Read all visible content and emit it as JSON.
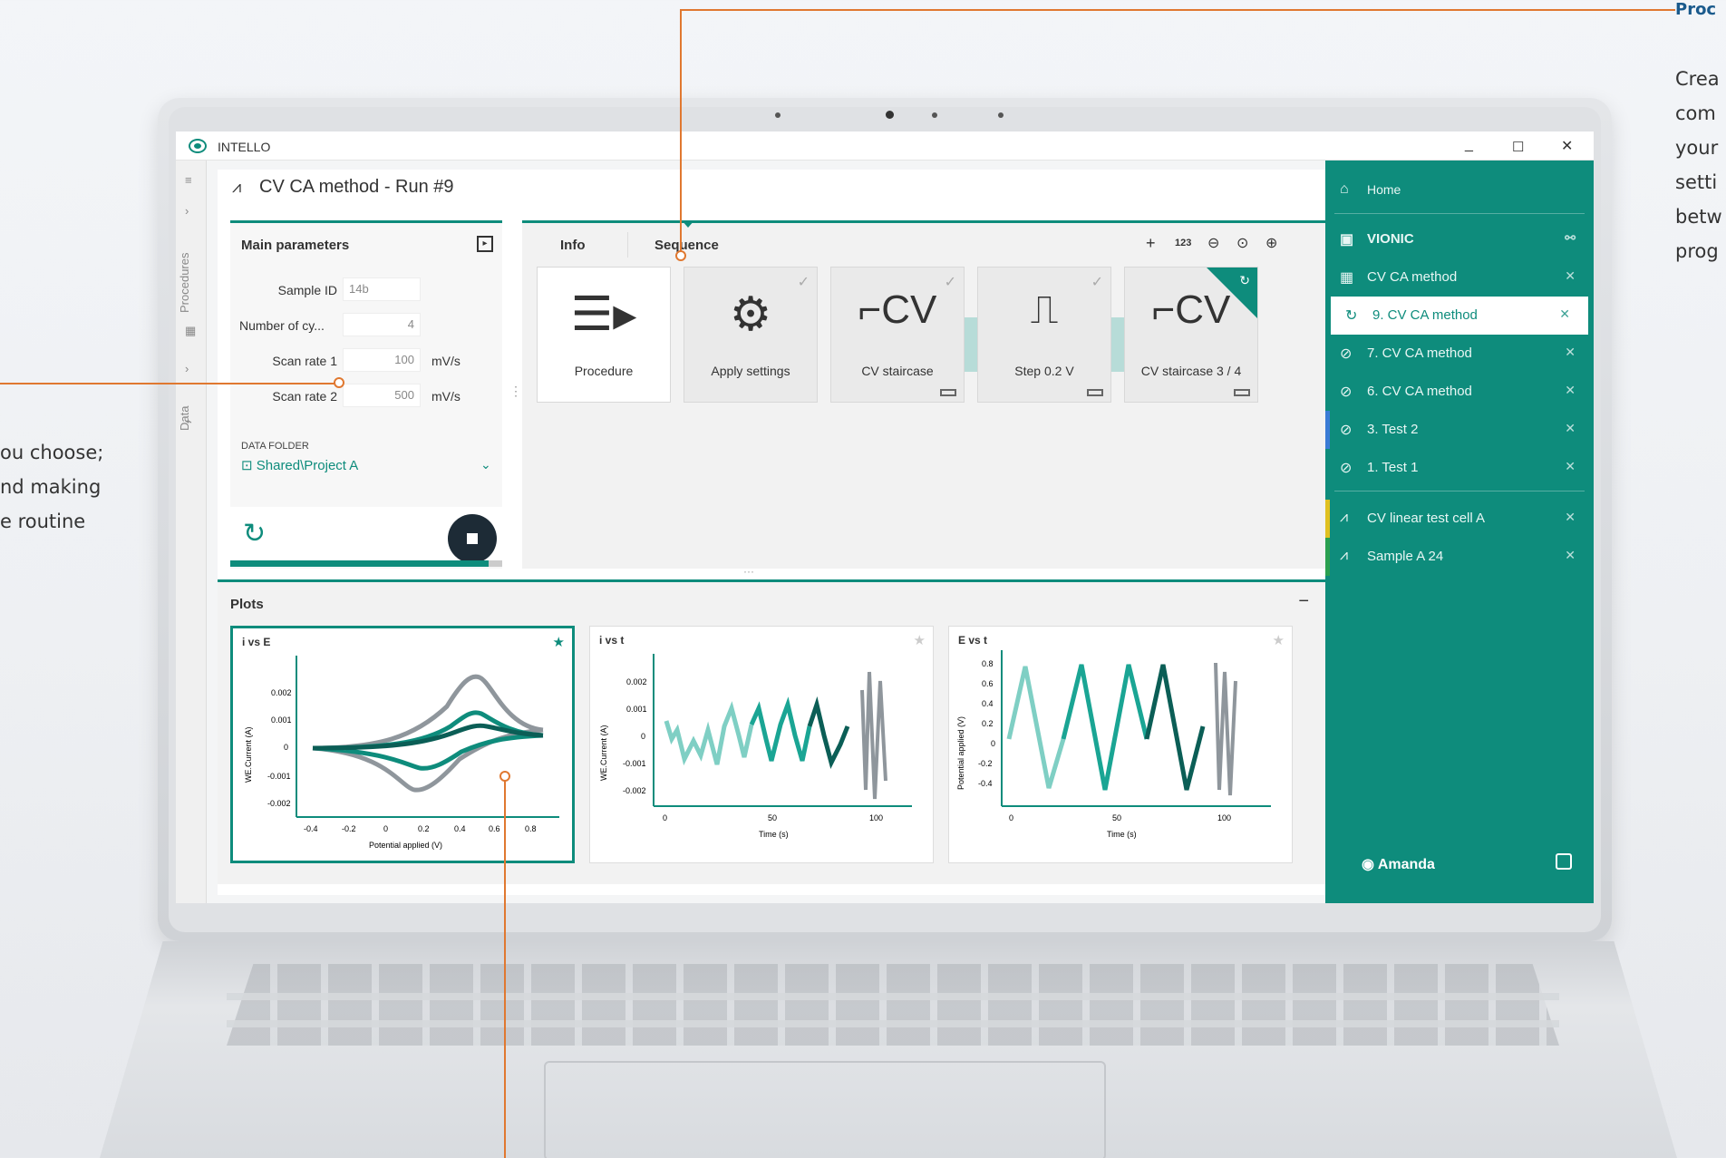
{
  "callouts": {
    "right_heading": "Proc",
    "right_lines": [
      "Crea",
      "com",
      "your",
      "setti",
      "betw",
      "prog"
    ],
    "left_lines": [
      "ou choose;",
      "nd making",
      "e routine"
    ]
  },
  "app": {
    "name": "INTELLO",
    "window_controls": {
      "minimize": "_",
      "maximize": "☐",
      "close": "✕"
    }
  },
  "left_rail": {
    "procedures_label": "Procedures",
    "data_label": "Data"
  },
  "run": {
    "title": "CV CA method - Run #9"
  },
  "main_parameters": {
    "header": "Main parameters",
    "fields": [
      {
        "label": "Sample ID",
        "value": "14b",
        "unit": ""
      },
      {
        "label": "Number of cy...",
        "value": "4",
        "unit": ""
      },
      {
        "label": "Scan rate 1",
        "value": "100",
        "unit": "mV/s"
      },
      {
        "label": "Scan rate 2",
        "value": "500",
        "unit": "mV/s"
      }
    ],
    "data_folder_label": "DATA FOLDER",
    "data_folder_value": "Shared\\Project A",
    "progress": 0.95
  },
  "sequence_panel": {
    "tabs": [
      "Info",
      "Sequence"
    ],
    "active_tab": "Sequence",
    "toolbar": {
      "add": "+",
      "numbers": "123",
      "zoom_out": "−",
      "zoom_fit": "⌕",
      "zoom_in": "+"
    },
    "cards": [
      {
        "label": "Procedure",
        "icon": "document-arrow-icon",
        "state": "none"
      },
      {
        "label": "Apply settings",
        "icon": "gear-icon",
        "state": "done"
      },
      {
        "label": "CV staircase",
        "icon": "cv-staircase-icon",
        "state": "done"
      },
      {
        "label": "Step 0.2 V",
        "icon": "step-pulse-icon",
        "state": "done"
      },
      {
        "label": "CV staircase 3 / 4",
        "icon": "cv-staircase-icon",
        "state": "running"
      }
    ]
  },
  "plots_panel": {
    "header": "Plots",
    "plots": [
      {
        "title": "i vs E",
        "starred": true,
        "y_ticks": [
          "0.002",
          "0.001",
          "0",
          "-0.001",
          "-0.002"
        ],
        "x_ticks": [
          "-0.4",
          "-0.2",
          "0",
          "0.2",
          "0.4",
          "0.6",
          "0.8"
        ],
        "xlabel": "Potential applied (V)",
        "ylabel": "WE.Current (A)"
      },
      {
        "title": "i vs t",
        "starred": false,
        "y_ticks": [
          "0.002",
          "0.001",
          "0",
          "-0.001",
          "-0.002"
        ],
        "x_ticks": [
          "0",
          "50",
          "100"
        ],
        "xlabel": "Time (s)",
        "ylabel": "WE.Current (A)"
      },
      {
        "title": "E vs t",
        "starred": false,
        "y_ticks": [
          "0.8",
          "0.6",
          "0.4",
          "0.2",
          "0",
          "-0.2",
          "-0.4"
        ],
        "x_ticks": [
          "0",
          "50",
          "100"
        ],
        "xlabel": "Time (s)",
        "ylabel": "Potential applied (V)"
      }
    ]
  },
  "sidebar": {
    "home": "Home",
    "device": "VIONIC",
    "items": [
      {
        "label": "CV CA method",
        "icon": "grid-icon",
        "active": false,
        "bar": ""
      },
      {
        "label": "9. CV CA method",
        "icon": "running-icon",
        "active": true,
        "bar": ""
      },
      {
        "label": "7. CV CA method",
        "icon": "check-circle-icon",
        "active": false,
        "bar": ""
      },
      {
        "label": "6. CV CA method",
        "icon": "check-circle-icon",
        "active": false,
        "bar": ""
      },
      {
        "label": "3. Test 2",
        "icon": "check-circle-icon",
        "active": false,
        "bar": "#3a7bd5"
      },
      {
        "label": "1. Test 1",
        "icon": "check-circle-icon",
        "active": false,
        "bar": ""
      }
    ],
    "data_items": [
      {
        "label": "CV linear test cell A",
        "bar": "#e0c020"
      },
      {
        "label": "Sample A 24",
        "bar": "#2aa050"
      }
    ],
    "user": "Amanda"
  },
  "colors": {
    "accent": "#0e8c7c",
    "accent_light": "#b7dcd8",
    "callout": "#e07830"
  }
}
